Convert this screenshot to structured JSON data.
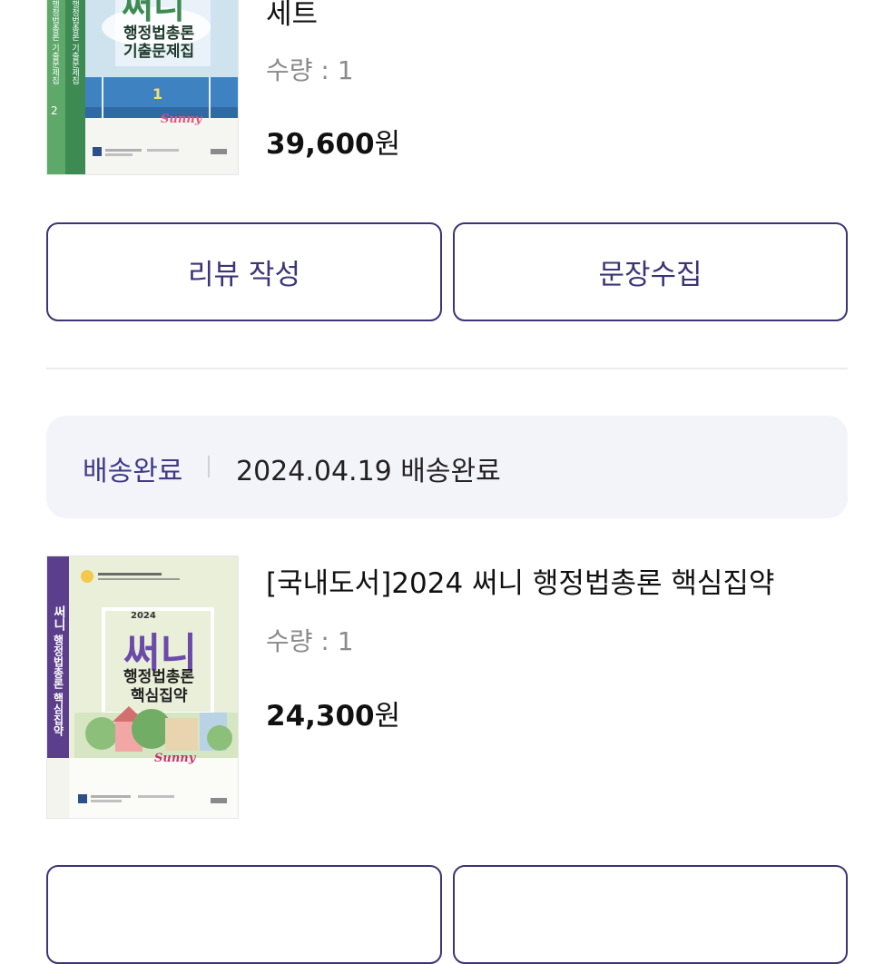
{
  "item1": {
    "title_tail": "세트",
    "qty_label": "수량 : 1",
    "price": "39,600",
    "currency": "원",
    "cover": {
      "brand": "써니",
      "subtitle_1": "행정법총론",
      "subtitle_2": "기출문제집",
      "spine_1": "행정법총론 기출문제집",
      "spine_2": "행정법총론 기출문제집",
      "vol_1": "1",
      "vol_2": "2",
      "script": "Sunny"
    }
  },
  "actions1": {
    "review_label": "리뷰 작성",
    "collect_label": "문장수집"
  },
  "order2": {
    "status_label": "배송완료",
    "status_detail": "2024.04.19 배송완료"
  },
  "item2": {
    "title": "[국내도서]2024 써니 행정법총론 핵심집약",
    "qty_label": "수량 : 1",
    "price": "24,300",
    "currency": "원",
    "cover": {
      "year": "2024",
      "brand": "써니",
      "subtitle_1": "행정법총론",
      "subtitle_2": "핵심집약",
      "spine": "행정법총론 핵심집약",
      "script": "Sunny"
    }
  }
}
